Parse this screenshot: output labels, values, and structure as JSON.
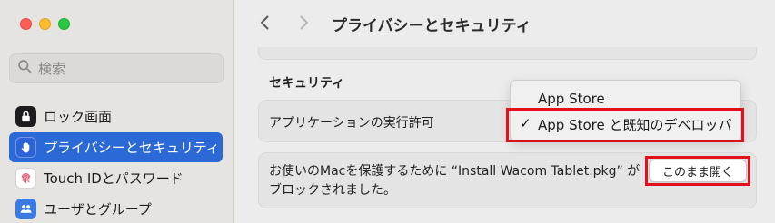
{
  "sidebar": {
    "search_placeholder": "検索",
    "items": [
      {
        "label": "ロック画面",
        "icon": "lock-icon"
      },
      {
        "label": "プライバシーとセキュリティ",
        "icon": "hand-icon"
      },
      {
        "label": "Touch IDとパスワード",
        "icon": "fingerprint-icon"
      },
      {
        "label": "ユーザとグループ",
        "icon": "users-icon"
      }
    ]
  },
  "header": {
    "title": "プライバシーとセキュリティ"
  },
  "main": {
    "section_title": "セキュリティ",
    "allow_apps_label": "アプリケーションの実行許可",
    "blocked_message": "お使いのMacを保護するために “Install Wacom Tablet.pkg” がブロックされました。",
    "open_anyway_label": "このまま開く"
  },
  "dropdown": {
    "options": [
      "App Store",
      "App Store と既知のデベロッパ"
    ],
    "selected": "App Store と既知のデベロッパ",
    "check_mark": "✓"
  },
  "colors": {
    "accent": "#2a69d6",
    "highlight": "#e2111c"
  }
}
